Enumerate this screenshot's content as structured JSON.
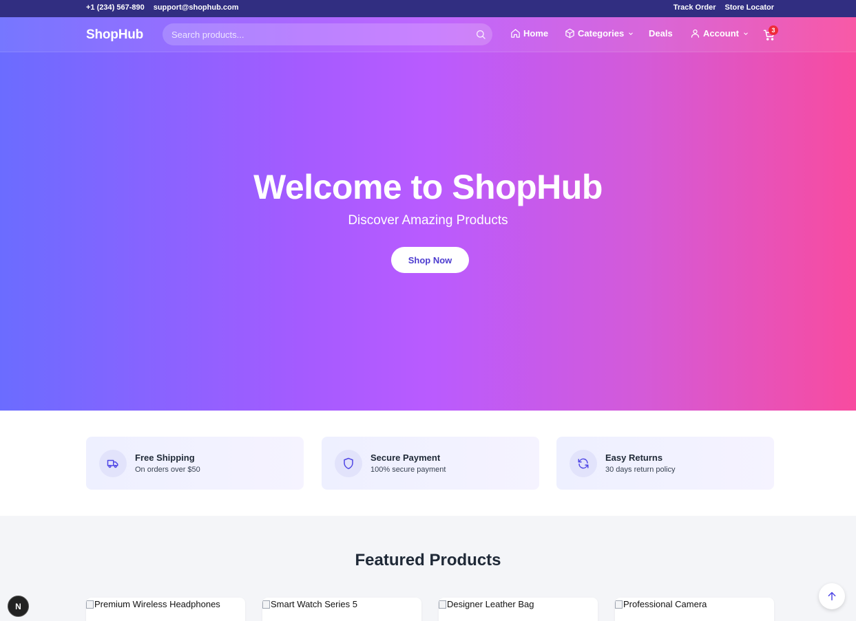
{
  "topbar": {
    "phone": "+1 (234) 567-890",
    "email": "support@shophub.com",
    "track_order": "Track Order",
    "store_locator": "Store Locator"
  },
  "navbar": {
    "logo": "ShopHub",
    "search_placeholder": "Search products...",
    "items": [
      {
        "label": "Home",
        "icon": "home-icon"
      },
      {
        "label": "Categories",
        "icon": "box-icon",
        "dropdown": true
      },
      {
        "label": "Deals"
      },
      {
        "label": "Account",
        "icon": "user-icon",
        "dropdown": true
      }
    ],
    "cart_count": "3"
  },
  "hero": {
    "title": "Welcome to ShopHub",
    "subtitle": "Discover Amazing Products",
    "cta": "Shop Now"
  },
  "features": [
    {
      "icon": "truck-icon",
      "title": "Free Shipping",
      "desc": "On orders over $50"
    },
    {
      "icon": "shield-icon",
      "title": "Secure Payment",
      "desc": "100% secure payment"
    },
    {
      "icon": "refresh-icon",
      "title": "Easy Returns",
      "desc": "30 days return policy"
    }
  ],
  "featured": {
    "title": "Featured Products",
    "products": [
      {
        "name": "Premium Wireless Headphones"
      },
      {
        "name": "Smart Watch Series 5"
      },
      {
        "name": "Designer Leather Bag"
      },
      {
        "name": "Professional Camera"
      }
    ]
  },
  "dev_badge": "N",
  "colors": {
    "topbar": "#312e81",
    "accent": "#4c3bcf",
    "badge": "#ef2b3a"
  }
}
